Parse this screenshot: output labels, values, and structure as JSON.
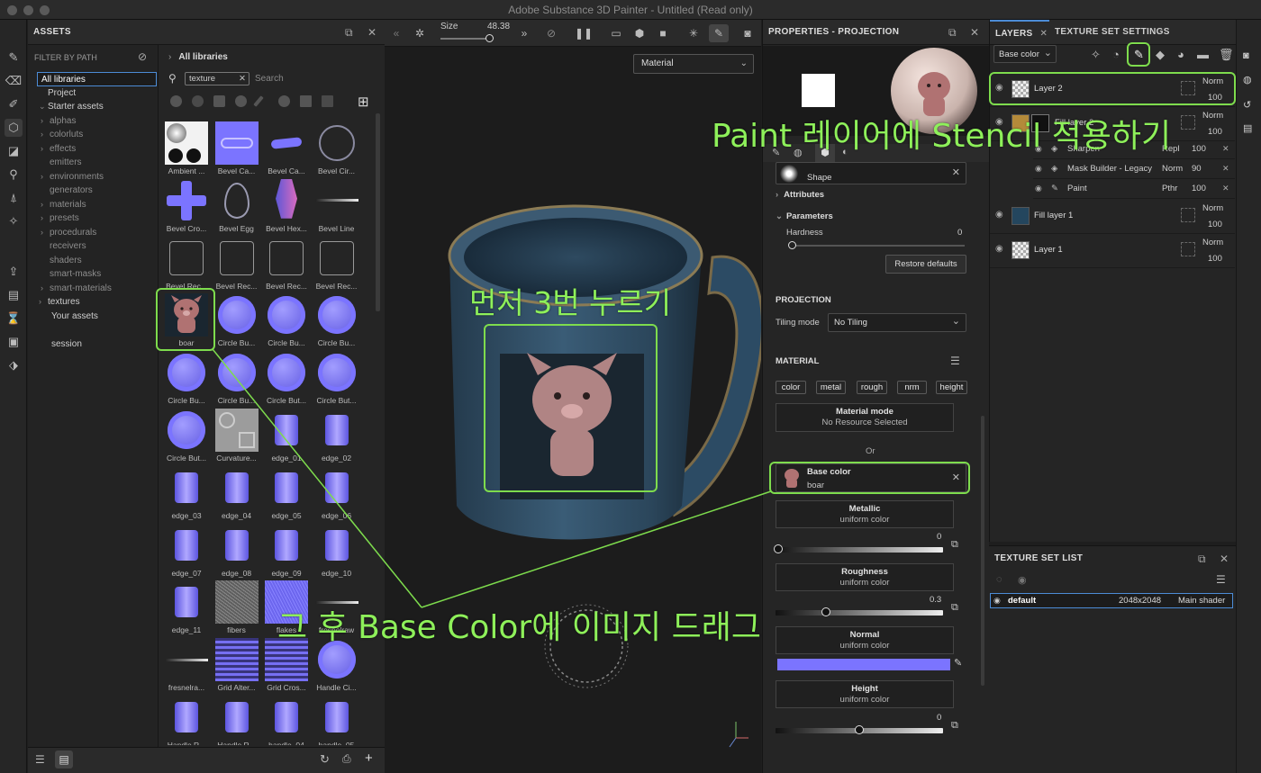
{
  "window": {
    "title": "Adobe Substance 3D Painter - Untitled (Read only)"
  },
  "assets": {
    "title": "ASSETS",
    "filter_title": "FILTER BY PATH",
    "filters": [
      {
        "label": "All libraries",
        "kind": "sel",
        "caret": ""
      },
      {
        "label": "Project",
        "kind": "top",
        "caret": ""
      },
      {
        "label": "Starter assets",
        "kind": "top",
        "caret": "⌄"
      },
      {
        "label": "alphas",
        "kind": "sub",
        "caret": "›"
      },
      {
        "label": "colorluts",
        "kind": "sub",
        "caret": "›"
      },
      {
        "label": "effects",
        "kind": "sub",
        "caret": "›"
      },
      {
        "label": "emitters",
        "kind": "sub",
        "caret": ""
      },
      {
        "label": "environments",
        "kind": "sub",
        "caret": "›"
      },
      {
        "label": "generators",
        "kind": "sub",
        "caret": ""
      },
      {
        "label": "materials",
        "kind": "sub",
        "caret": "›"
      },
      {
        "label": "presets",
        "kind": "sub",
        "caret": "›"
      },
      {
        "label": "procedurals",
        "kind": "sub",
        "caret": "›"
      },
      {
        "label": "receivers",
        "kind": "sub",
        "caret": ""
      },
      {
        "label": "shaders",
        "kind": "sub",
        "caret": ""
      },
      {
        "label": "smart-masks",
        "kind": "sub",
        "caret": ""
      },
      {
        "label": "smart-materials",
        "kind": "sub",
        "caret": "›"
      },
      {
        "label": "textures",
        "kind": "top2",
        "caret": "›"
      },
      {
        "label": "Your assets",
        "kind": "top2",
        "caret": ""
      },
      {
        "label": "",
        "kind": "blank",
        "caret": ""
      },
      {
        "label": "session",
        "kind": "top2",
        "caret": ""
      }
    ],
    "breadcrumb": "All libraries",
    "search_chip": "texture",
    "search_placeholder": "Search",
    "tiles": [
      {
        "label": "Ambient ...",
        "kind": "ambient"
      },
      {
        "label": "Bevel Ca...",
        "kind": "normal"
      },
      {
        "label": "Bevel Ca...",
        "kind": "pill"
      },
      {
        "label": "Bevel Cir...",
        "kind": "ring"
      },
      {
        "label": "Bevel Cro...",
        "kind": "cross"
      },
      {
        "label": "Bevel Egg",
        "kind": "egg"
      },
      {
        "label": "Bevel Hex...",
        "kind": "hex"
      },
      {
        "label": "Bevel Line",
        "kind": "line"
      },
      {
        "label": "Bevel Rec...",
        "kind": "rect"
      },
      {
        "label": "Bevel Rec...",
        "kind": "rect"
      },
      {
        "label": "Bevel Rec...",
        "kind": "rect"
      },
      {
        "label": "Bevel Rec...",
        "kind": "rect"
      },
      {
        "label": "boar",
        "kind": "boar"
      },
      {
        "label": "Circle Bu...",
        "kind": "circle"
      },
      {
        "label": "Circle Bu...",
        "kind": "circle"
      },
      {
        "label": "Circle Bu...",
        "kind": "circle"
      },
      {
        "label": "Circle Bu...",
        "kind": "circle"
      },
      {
        "label": "Circle Bu...",
        "kind": "circle"
      },
      {
        "label": "Circle But...",
        "kind": "circle"
      },
      {
        "label": "Circle But...",
        "kind": "circle"
      },
      {
        "label": "Circle But...",
        "kind": "circle"
      },
      {
        "label": "Curvature...",
        "kind": "gray"
      },
      {
        "label": "edge_01",
        "kind": "edge"
      },
      {
        "label": "edge_02",
        "kind": "edge"
      },
      {
        "label": "edge_03",
        "kind": "edge"
      },
      {
        "label": "edge_04",
        "kind": "edge"
      },
      {
        "label": "edge_05",
        "kind": "edge"
      },
      {
        "label": "edge_06",
        "kind": "edge"
      },
      {
        "label": "edge_07",
        "kind": "edge"
      },
      {
        "label": "edge_08",
        "kind": "edge"
      },
      {
        "label": "edge_09",
        "kind": "edge"
      },
      {
        "label": "edge_10",
        "kind": "edge"
      },
      {
        "label": "edge_11",
        "kind": "edge"
      },
      {
        "label": "fibers",
        "kind": "noise"
      },
      {
        "label": "flakes",
        "kind": "flakes"
      },
      {
        "label": "fresnelraw",
        "kind": "line"
      },
      {
        "label": "fresnelra...",
        "kind": "line"
      },
      {
        "label": "Grid Alter...",
        "kind": "gridtex"
      },
      {
        "label": "Grid Cros...",
        "kind": "gridtex"
      },
      {
        "label": "Handle Ci...",
        "kind": "circle"
      },
      {
        "label": "Handle R...",
        "kind": "edge"
      },
      {
        "label": "Handle R...",
        "kind": "edge"
      },
      {
        "label": "handle_04",
        "kind": "edge"
      },
      {
        "label": "handle_05",
        "kind": "edge"
      }
    ]
  },
  "viewport": {
    "size_label": "Size",
    "size_value": "48.38",
    "material_dropdown": "Material"
  },
  "properties": {
    "title": "PROPERTIES - PROJECTION",
    "stencil_label": "Shape",
    "attributes": "Attributes",
    "parameters": "Parameters",
    "hardness_label": "Hardness",
    "hardness_value": "0",
    "restore": "Restore defaults",
    "projection_title": "PROJECTION",
    "tiling_label": "Tiling mode",
    "tiling_value": "No Tiling",
    "material_title": "MATERIAL",
    "channels": [
      "color",
      "metal",
      "rough",
      "nrm",
      "height"
    ],
    "material_mode": "Material mode",
    "material_mode_value": "No Resource Selected",
    "or": "Or",
    "base_color": "Base color",
    "base_color_value": "boar",
    "metallic": "Metallic",
    "metallic_sub": "uniform color",
    "metallic_value": "0",
    "roughness": "Roughness",
    "roughness_sub": "uniform color",
    "roughness_value": "0.3",
    "normal": "Normal",
    "normal_sub": "uniform color",
    "height": "Height",
    "height_sub": "uniform color",
    "height_value": "0",
    "accent": "#7b74ff"
  },
  "layers": {
    "tab_layers": "LAYERS",
    "tab_tss": "TEXTURE SET SETTINGS",
    "channel_dropdown": "Base color",
    "rows": [
      {
        "name": "Layer 2",
        "blend": "Norm",
        "opacity": "100"
      },
      {
        "name": "Fill layer 2",
        "blend": "Norm",
        "opacity": "100"
      }
    ],
    "effects": [
      {
        "name": "Sharpen",
        "blend": "Repl",
        "opacity": "100"
      },
      {
        "name": "Mask Builder - Legacy",
        "blend": "Norm",
        "opacity": "90"
      },
      {
        "name": "Paint",
        "blend": "Pthr",
        "opacity": "100"
      }
    ],
    "rows2": [
      {
        "name": "Fill layer 1",
        "blend": "Norm",
        "opacity": "100"
      },
      {
        "name": "Layer 1",
        "blend": "Norm",
        "opacity": "100"
      }
    ]
  },
  "texture_set_list": {
    "title": "TEXTURE SET LIST",
    "name": "default",
    "size": "2048x2048",
    "shader": "Main shader"
  },
  "annotations": {
    "stencil": "Paint 레이어에 Stencil 적용하기",
    "press3": "먼저 3번 누르기",
    "drag": "그 후 Base Color에 이미지 드래그",
    "color": "#8ef05a"
  }
}
